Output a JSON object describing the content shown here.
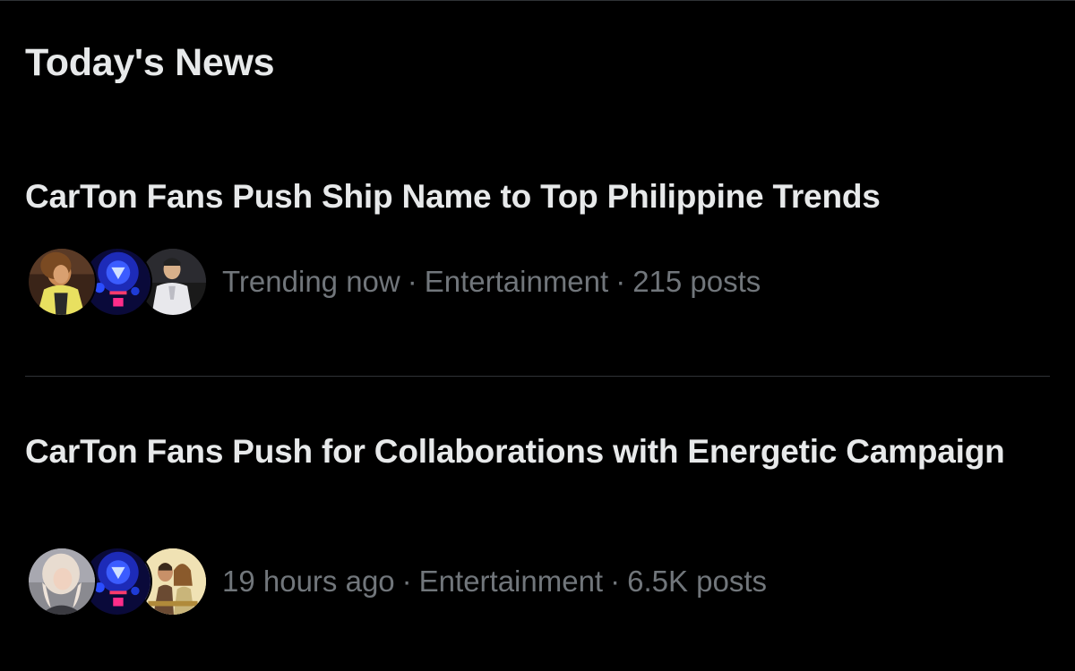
{
  "section": {
    "title": "Today's News"
  },
  "news": [
    {
      "headline": "CarTon Fans Push Ship Name to Top Philippine Trends",
      "time": "Trending now",
      "category": "Entertainment",
      "posts": "215 posts",
      "avatars": [
        "avatar-woman-yellow-jacket",
        "avatar-blue-stage-lights",
        "avatar-man-white-suit"
      ]
    },
    {
      "headline": "CarTon Fans Push for Collaborations with Energetic Campaign",
      "time": "19 hours ago",
      "category": "Entertainment",
      "posts": "6.5K posts",
      "avatars": [
        "avatar-woman-blonde",
        "avatar-blue-stage-lights",
        "avatar-couple-poster"
      ]
    }
  ],
  "separator": "·",
  "colors": {
    "background": "#000000",
    "primary_text": "#e7e9ea",
    "secondary_text": "#71767b",
    "divider": "#2f3336"
  }
}
